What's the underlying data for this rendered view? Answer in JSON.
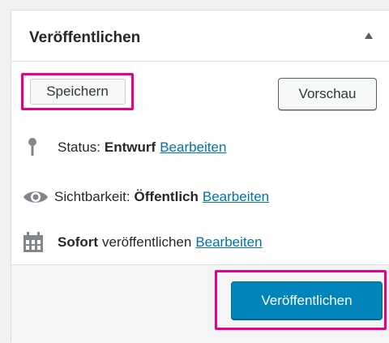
{
  "panel": {
    "title": "Veröffentlichen"
  },
  "buttons": {
    "save_label": "Speichern",
    "preview_label": "Vorschau",
    "publish_label": "Veröffentlichen"
  },
  "status": {
    "label": "Status:",
    "value": "Entwurf",
    "edit_link": "Bearbeiten",
    "icon": "pin-icon"
  },
  "visibility": {
    "label": "Sichtbarkeit:",
    "value": "Öffentlich",
    "edit_link": "Bearbeiten",
    "icon": "eye-icon"
  },
  "schedule": {
    "value": "Sofort",
    "label": "veröffentlichen",
    "edit_link": "Bearbeiten",
    "icon": "calendar-icon"
  },
  "colors": {
    "highlight": "#e6008a",
    "primary": "#0085ba",
    "link": "#0073aa"
  }
}
